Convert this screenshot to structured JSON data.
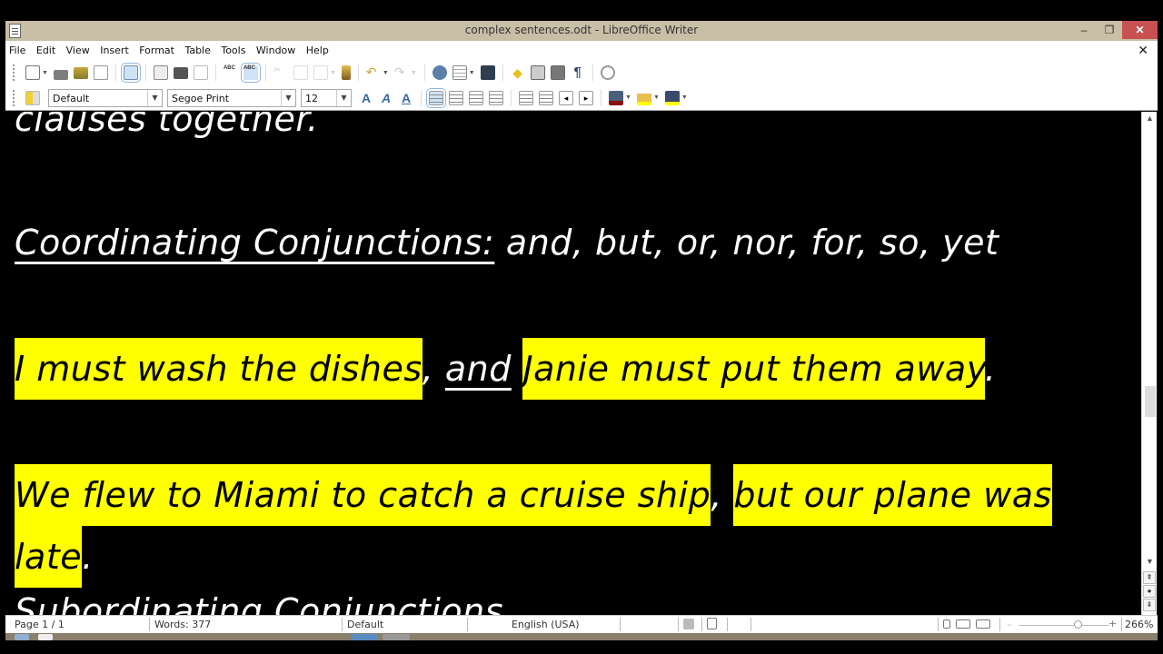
{
  "window": {
    "title": "complex sentences.odt - LibreOffice Writer",
    "minimize_label": "–",
    "maximize_label": "❐",
    "close_label": "✕"
  },
  "menubar": {
    "items": [
      "File",
      "Edit",
      "View",
      "Insert",
      "Format",
      "Table",
      "Tools",
      "Window",
      "Help"
    ],
    "close_document_label": "✕"
  },
  "toolbar_standard": {
    "icons": [
      "new-document-icon",
      "open-icon",
      "save-icon",
      "email-icon",
      "edit-mode-icon",
      "export-pdf-icon",
      "print-icon",
      "print-preview-icon",
      "spellcheck-icon",
      "autospellcheck-icon",
      "cut-icon",
      "copy-icon",
      "paste-icon",
      "clone-formatting-icon",
      "undo-icon",
      "redo-icon",
      "hyperlink-icon",
      "table-icon",
      "show-draw-functions-icon",
      "navigator-icon",
      "gallery-icon",
      "data-sources-icon",
      "formatting-marks-icon",
      "help-icon"
    ]
  },
  "toolbar_formatting": {
    "paragraph_style": "Default",
    "font_name": "Segoe Print",
    "font_size": "12",
    "icons": [
      "bold-icon",
      "italic-icon",
      "underline-icon",
      "align-left-icon",
      "align-center-icon",
      "align-right-icon",
      "justify-icon",
      "numbering-icon",
      "bullets-icon",
      "decrease-indent-icon",
      "increase-indent-icon",
      "font-color-icon",
      "highlight-icon",
      "background-color-icon"
    ]
  },
  "document": {
    "line1": "clauses together.",
    "heading_label": "Coordinating Conjunctions:",
    "heading_list": " and, but, or, nor, for, so, yet",
    "sentence1": {
      "clause1": "I must wash the dishes",
      "comma": ", ",
      "conjunction": "and",
      "space": " ",
      "clause2": "Janie must put them away",
      "period": "."
    },
    "sentence2": {
      "clause1_a": "We flew to Miami to catch a cruise ship",
      "comma": ", ",
      "clause2_a": "but our plane was ",
      "clause2_b": "late",
      "period": "."
    },
    "next_heading_partial": "Subordinating Conjunctions"
  },
  "statusbar": {
    "page": "Page 1 / 1",
    "words": "Words: 377",
    "page_style": "Default",
    "language": "English (USA)",
    "zoom_percent": "266%",
    "zoom_minus": "–",
    "zoom_plus": "+"
  },
  "colors": {
    "highlight": "#ffff00",
    "titlebar": "#c9bea6",
    "close_button": "#c75050"
  }
}
